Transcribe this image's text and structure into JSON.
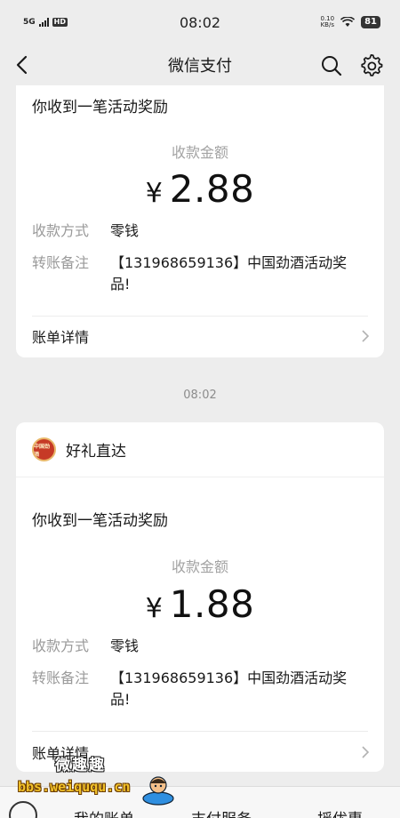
{
  "status_bar": {
    "network": "5G",
    "hd": "HD",
    "time": "08:02",
    "speed_value": "0.10",
    "speed_unit": "KB/s",
    "battery": "81"
  },
  "nav": {
    "title": "微信支付"
  },
  "messages": [
    {
      "title": "你收到一笔活动奖励",
      "amount_label": "收款金额",
      "currency": "¥",
      "amount": "2.88",
      "method_label": "收款方式",
      "method_value": "零钱",
      "note_label": "转账备注",
      "note_value": "【131968659136】中国劲酒活动奖品!",
      "detail_label": "账单详情"
    },
    {
      "time": "08:02",
      "merchant": "好礼直达",
      "merchant_logo_text": "中国劲酒",
      "title": "你收到一笔活动奖励",
      "amount_label": "收款金额",
      "currency": "¥",
      "amount": "1.88",
      "method_label": "收款方式",
      "method_value": "零钱",
      "note_label": "转账备注",
      "note_value": "【131968659136】中国劲酒活动奖品!",
      "detail_label": "账单详情"
    }
  ],
  "bottom_menu": {
    "items": [
      "我的账单",
      "支付服务",
      "摇优惠"
    ]
  },
  "watermark": {
    "text_cn": "微趣趣",
    "url": "bbs.weiququ.cn"
  }
}
